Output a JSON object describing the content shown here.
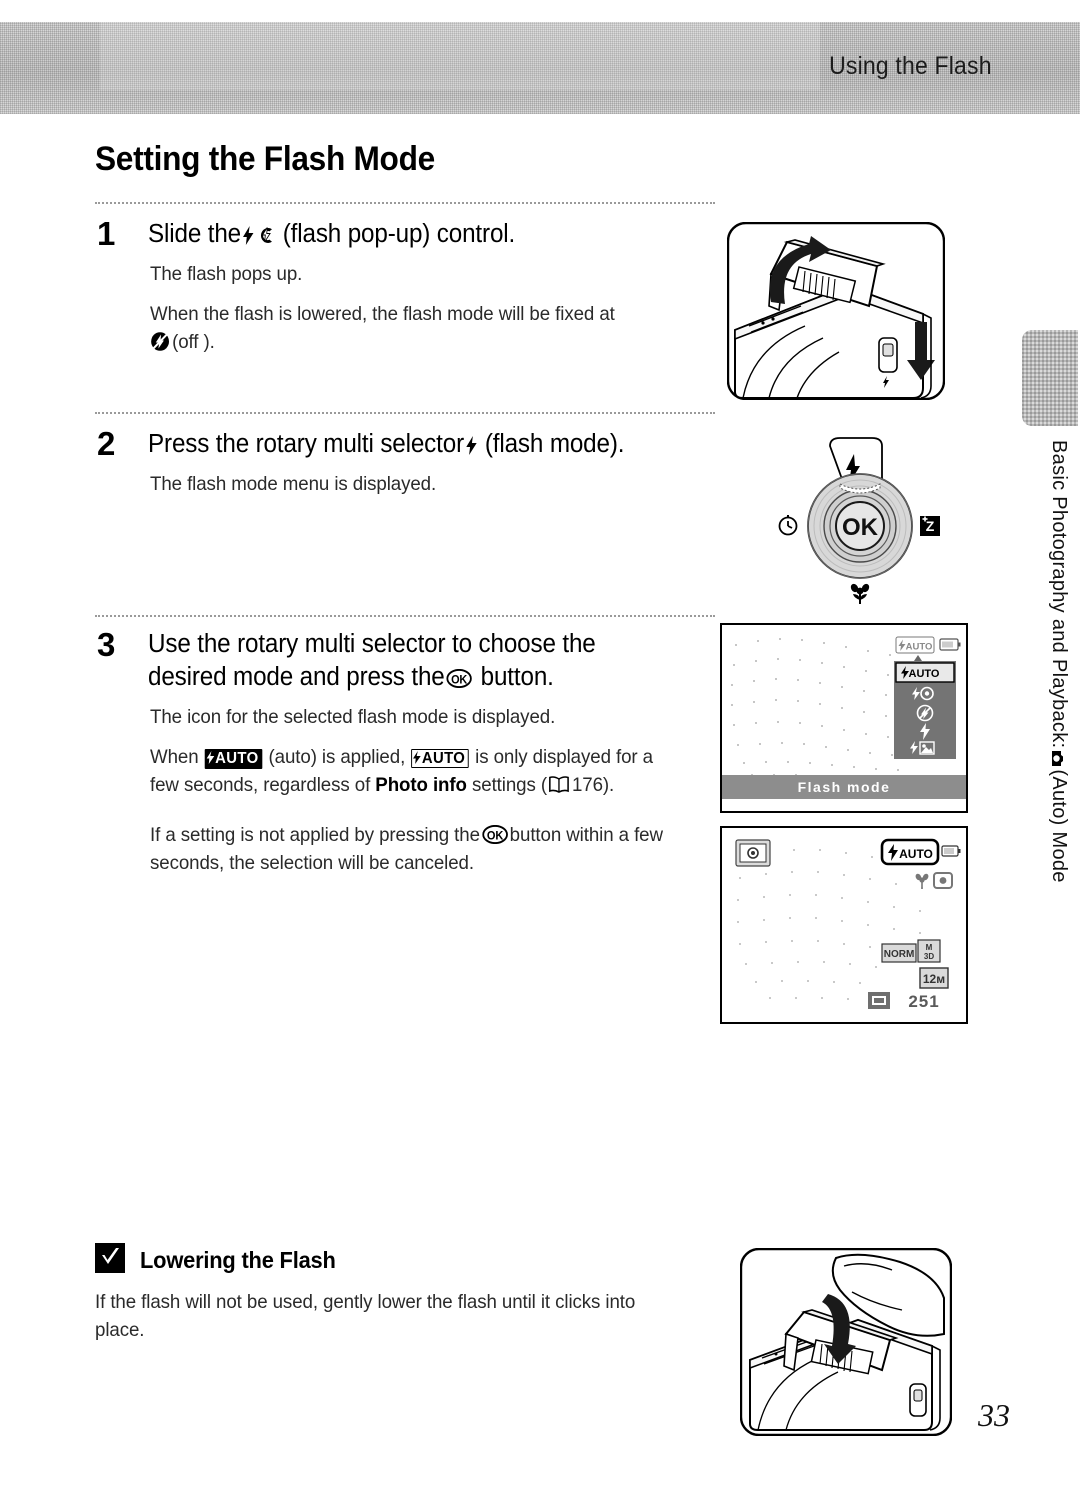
{
  "header": {
    "section_title": "Using the Flash"
  },
  "page_title": "Setting the Flash Mode",
  "steps": [
    {
      "number": "1",
      "heading_pre": "Slide the",
      "heading_post": "(flash pop-up) control.",
      "body_line_1": "The flash pops up.",
      "body_line_2_pre": "When the flash is lowered, the flash mode will be fixed at",
      "body_line_2_post": "(off )."
    },
    {
      "number": "2",
      "heading_pre": "Press the rotary multi selector",
      "heading_post": "(flash mode).",
      "body_line_1": "The flash mode menu is displayed."
    },
    {
      "number": "3",
      "heading_pre": "Use the rotary multi selector to choose the desired mode and press the",
      "heading_post": "button.",
      "body_line_1": "The icon for the selected flash mode is displayed.",
      "body_line_2_a": "When",
      "body_line_2_b": "(auto) is applied,",
      "body_line_2_c": "is only displayed for a few seconds, regardless of",
      "body_line_2_bold": "Photo info",
      "body_line_2_d": "settings (",
      "body_line_2_page": "176",
      "body_line_2_e": ").",
      "body_line_3_a": "If a setting is not applied by pressing the",
      "body_line_3_b": "button within a few seconds, the selection will be canceled."
    }
  ],
  "note": {
    "title": "Lowering the Flash",
    "body": "If the flash will not be used, gently lower the flash until it clicks into place."
  },
  "side_tab": {
    "text_before": "Basic Photography and Playback:",
    "text_after": "(Auto) Mode"
  },
  "lcd_menu_screen": {
    "status_badge": "AUTO",
    "caption": "Flash mode",
    "options": [
      {
        "name": "flash-auto",
        "label": "AUTO",
        "selected": true
      },
      {
        "name": "red-eye-reduction",
        "label": "",
        "selected": false
      },
      {
        "name": "flash-off",
        "label": "",
        "selected": false
      },
      {
        "name": "fill-flash",
        "label": "",
        "selected": false
      },
      {
        "name": "slow-sync",
        "label": "",
        "selected": false
      }
    ]
  },
  "lcd_live_screen": {
    "flash_badge": "AUTO",
    "image_size": "12м",
    "shots_remaining": "251",
    "quality": "NORM"
  },
  "page_number": "33",
  "icons": {
    "bolt": "flash-bolt-icon",
    "popup": "flash-popup-control-icon",
    "flash_off": "flash-off-icon",
    "ok": "ok-button-icon",
    "book": "reference-book-icon",
    "camera": "camera-auto-mode-icon",
    "check": "note-check-icon"
  }
}
